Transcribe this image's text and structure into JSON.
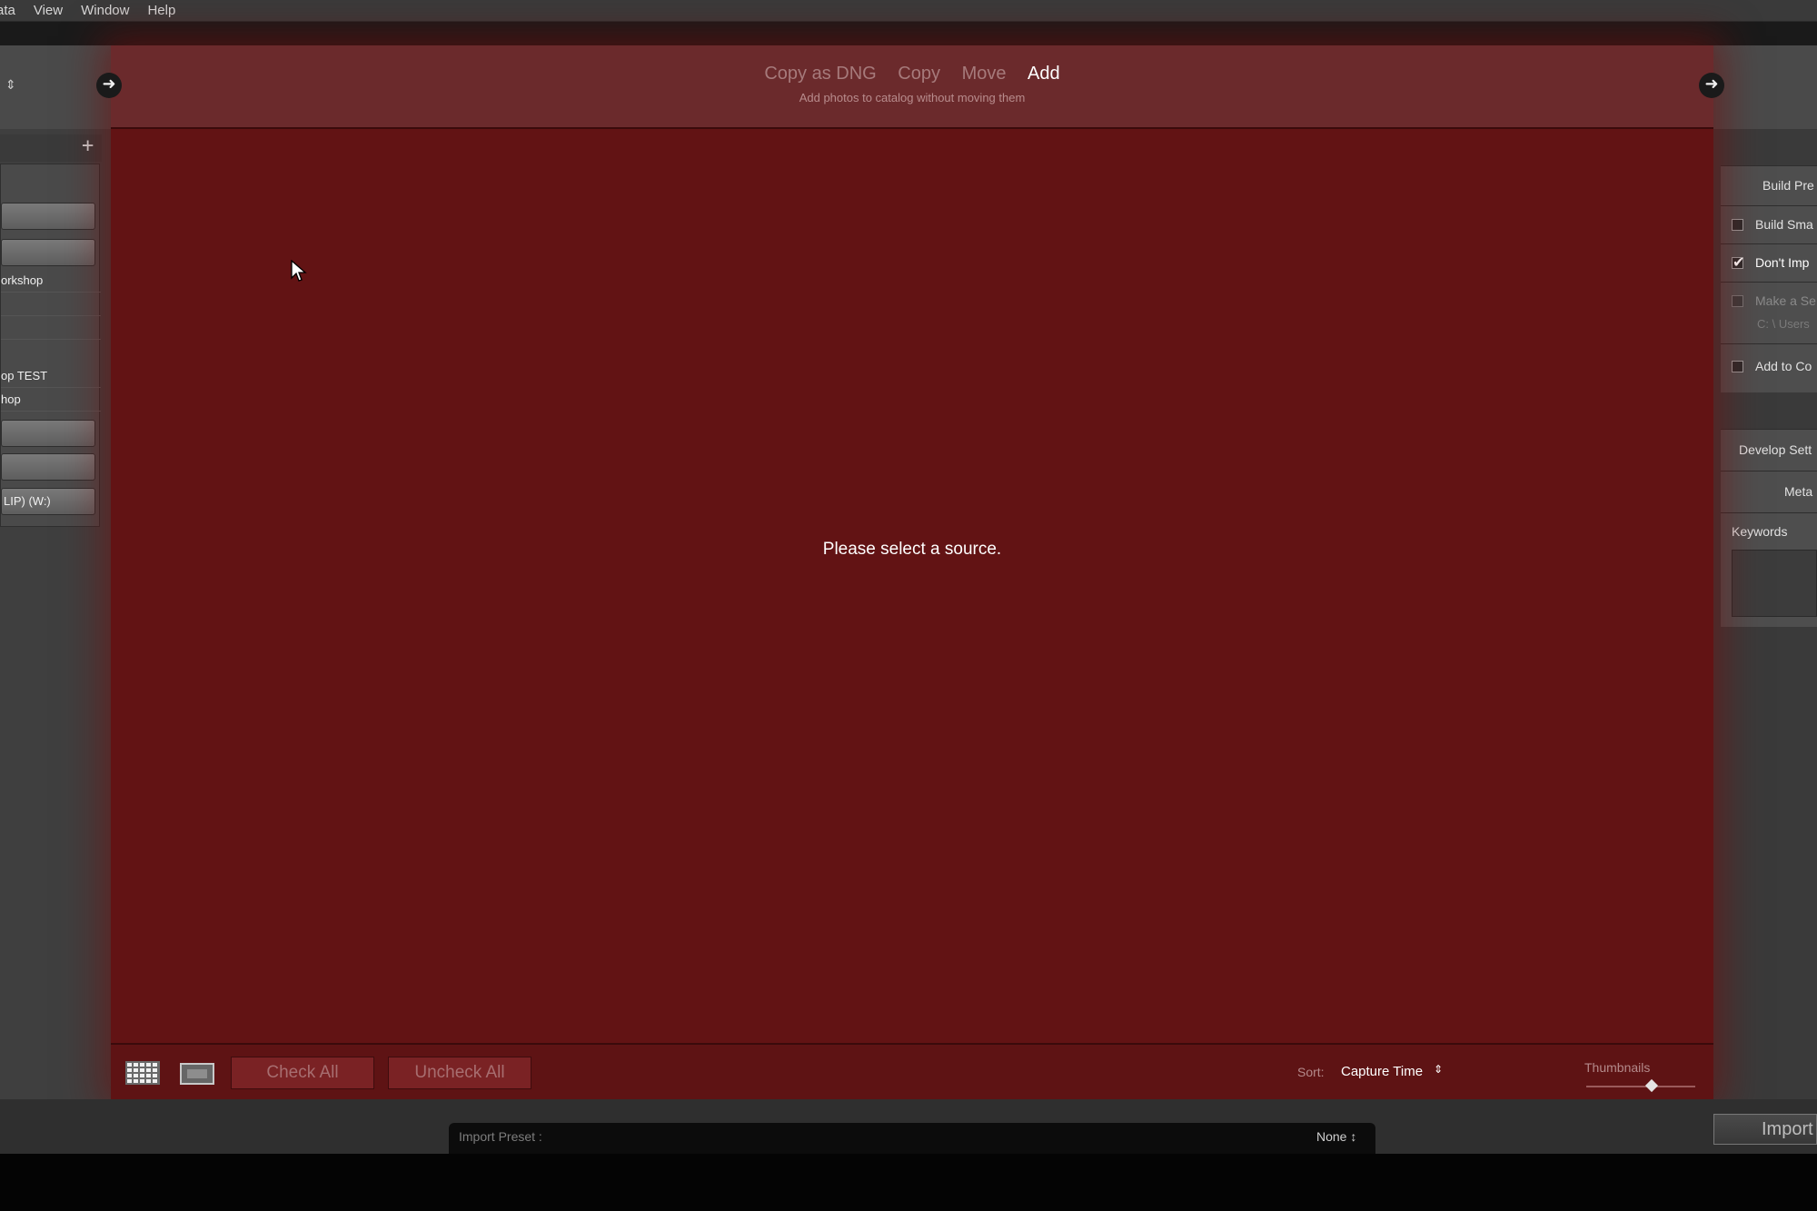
{
  "menubar": {
    "items": [
      "ata",
      "View",
      "Window",
      "Help"
    ]
  },
  "import_modes": {
    "items": [
      {
        "label": "Copy as DNG",
        "active": false
      },
      {
        "label": "Copy",
        "active": false
      },
      {
        "label": "Move",
        "active": false
      },
      {
        "label": "Add",
        "active": true
      }
    ],
    "description": "Add photos to catalog without moving them"
  },
  "left_panel": {
    "plus": "+",
    "items": [
      "",
      "",
      "orkshop",
      "",
      "",
      "op TEST",
      "hop",
      "",
      "",
      "LIP) (W:)"
    ]
  },
  "center": {
    "empty_message": "Please select a source."
  },
  "toolbar": {
    "check_all": "Check All",
    "uncheck_all": "Uncheck All",
    "sort_label": "Sort:",
    "sort_value": "Capture Time",
    "thumbnails_label": "Thumbnails",
    "thumbnail_size": 0.6
  },
  "right_panel": {
    "build_previews": "Build Pre",
    "build_smart": "Build Sma",
    "dont_import": "Don't Imp",
    "make_second": "Make a Se",
    "second_path": "C: \\ Users",
    "add_to_collection": "Add to Co",
    "develop_settings": "Develop Sett",
    "metadata": "Meta",
    "keywords": "Keywords"
  },
  "bottom": {
    "preset_label": "Import Preset :",
    "preset_value": "None ↕",
    "import_button": "Import"
  },
  "colors": {
    "overlay_red": "#621314",
    "panel_gray": "#4a4a4a"
  }
}
